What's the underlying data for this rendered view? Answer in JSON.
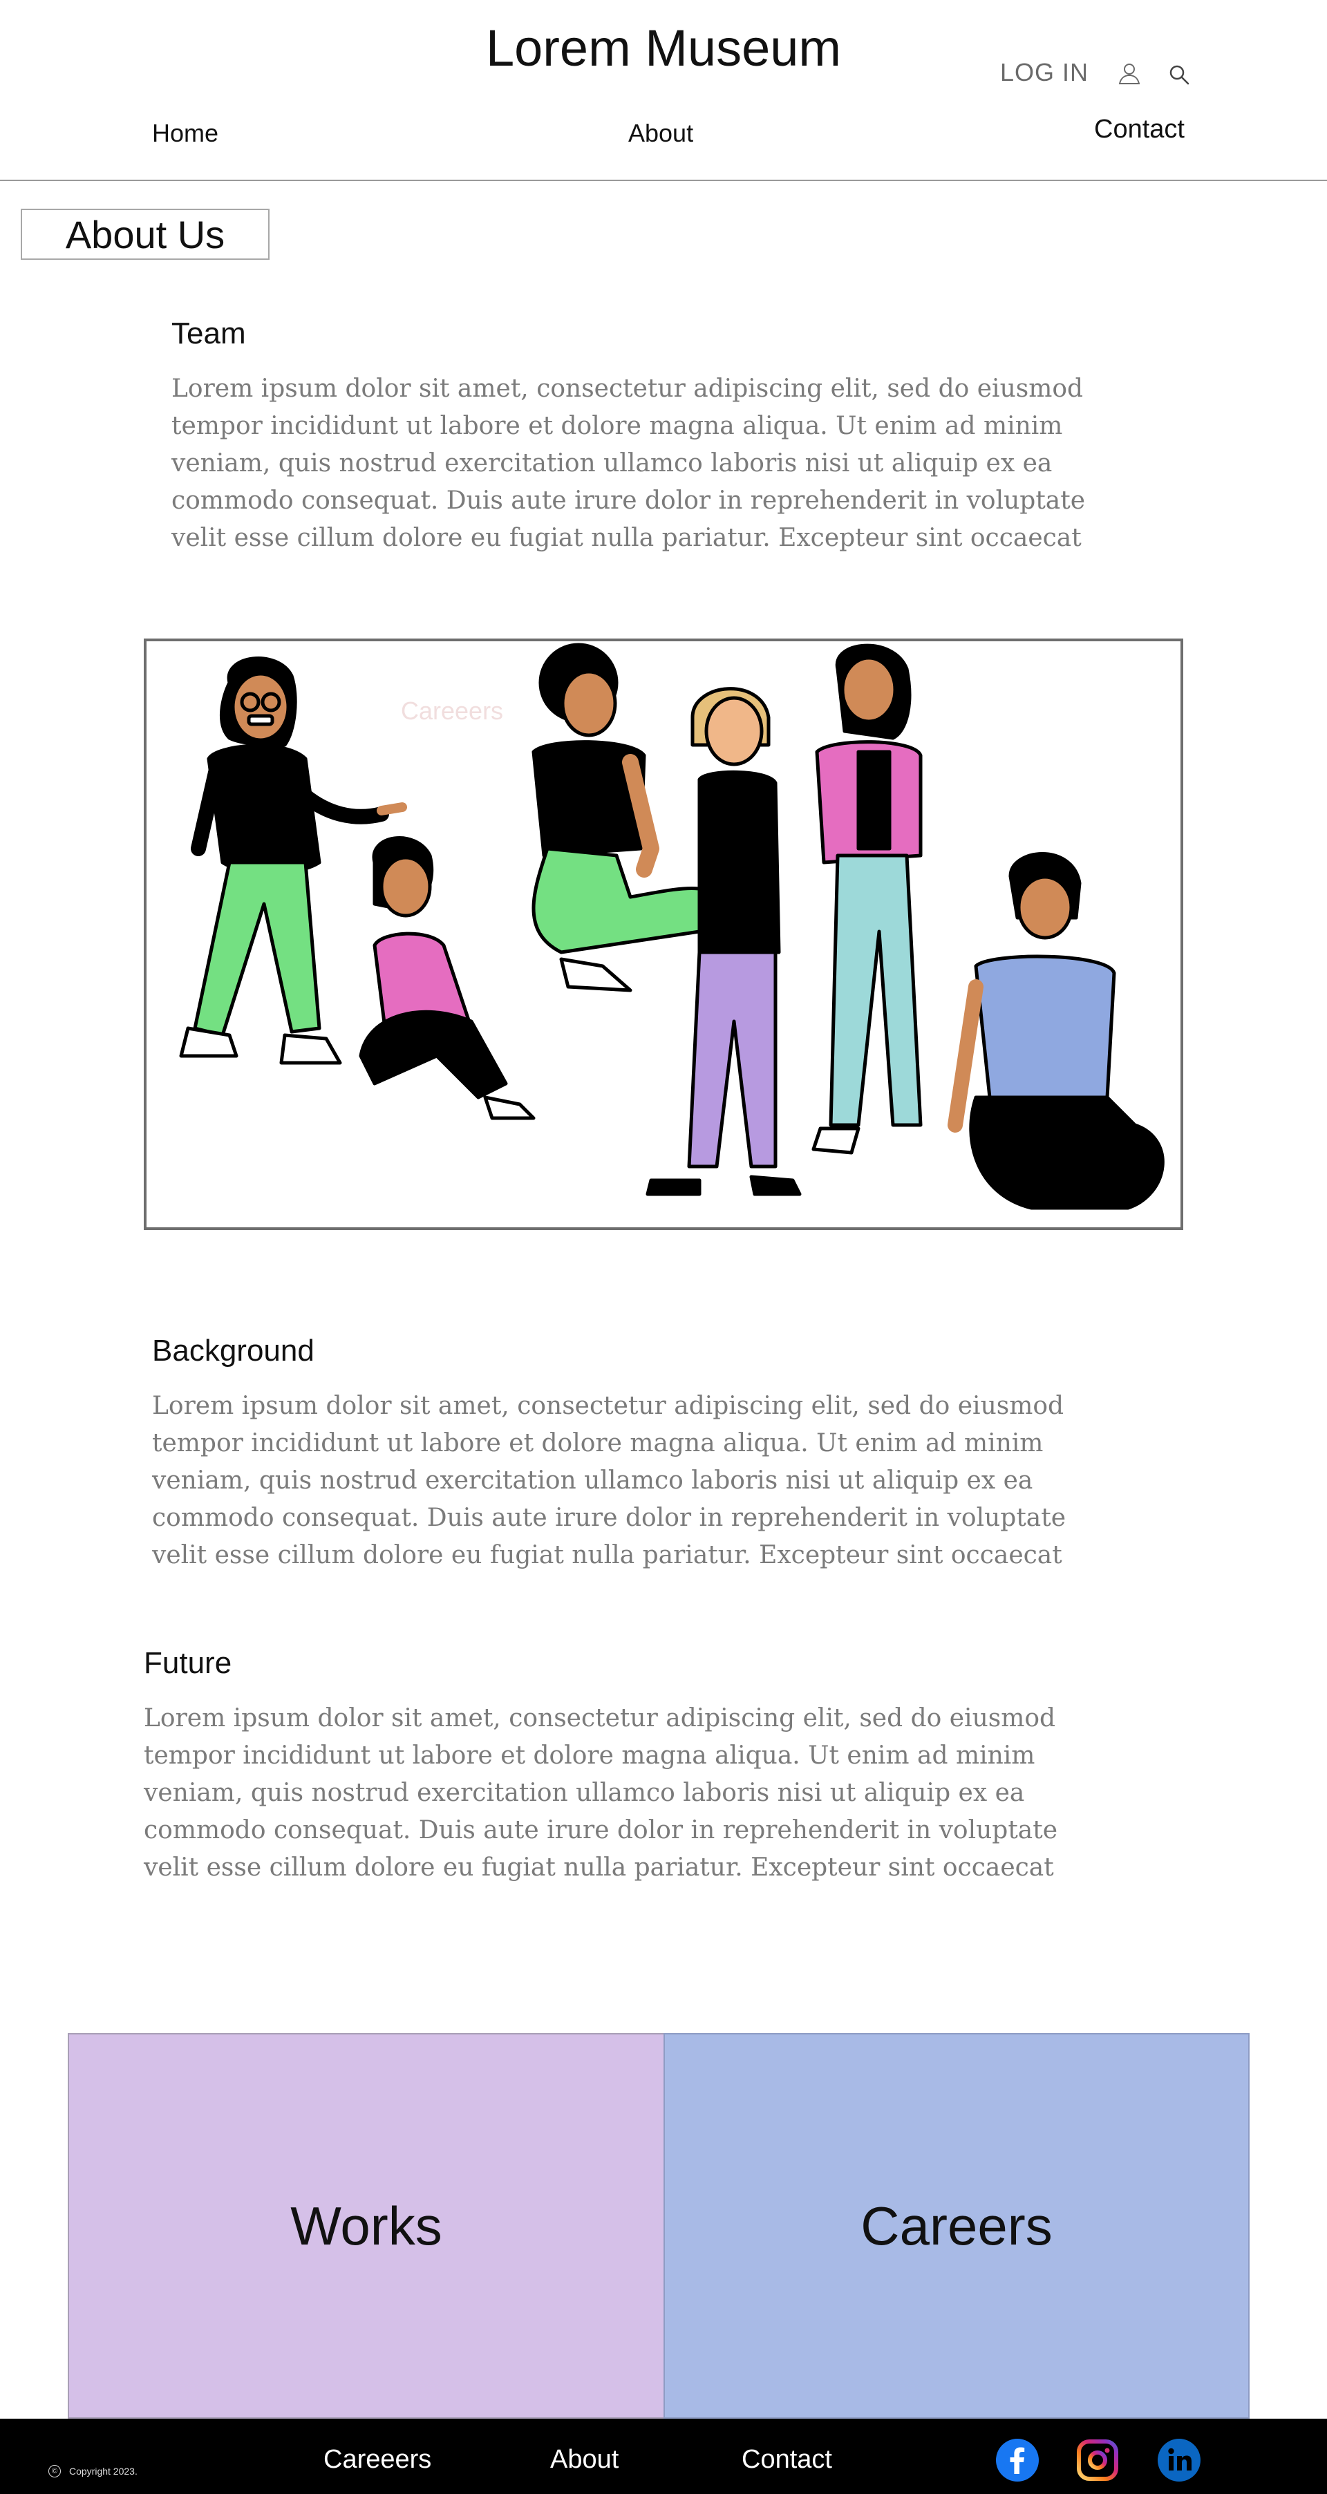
{
  "header": {
    "site_title": "Lorem Museum",
    "login_label": "LOG IN",
    "user_icon": "user-icon",
    "search_icon": "search-icon"
  },
  "nav": {
    "home": "Home",
    "about": "About",
    "contact": "Contact"
  },
  "page": {
    "heading": "About Us"
  },
  "sections": {
    "team": {
      "title": "Team",
      "lines": [
        "Lorem ipsum dolor sit amet, consectetur adipiscing elit, sed do eiusmod",
        "tempor incididunt ut labore et dolore magna aliqua. Ut enim ad minim",
        "veniam, quis nostrud exercitation ullamco laboris nisi ut aliquip ex ea",
        "commodo consequat. Duis aute irure dolor in reprehenderit in voluptate",
        "velit esse cillum dolore eu fugiat nulla pariatur. Excepteur sint occaecat"
      ]
    },
    "background": {
      "title": "Background",
      "lines": [
        "Lorem ipsum dolor sit amet, consectetur adipiscing elit, sed do eiusmod",
        "tempor incididunt ut labore et dolore magna aliqua. Ut enim ad minim",
        "veniam, quis nostrud exercitation ullamco laboris nisi ut aliquip ex ea",
        "commodo consequat. Duis aute irure dolor in reprehenderit in voluptate",
        "velit esse cillum dolore eu fugiat nulla pariatur. Excepteur sint occaecat"
      ]
    },
    "future": {
      "title": "Future",
      "lines": [
        "Lorem ipsum dolor sit amet, consectetur adipiscing elit, sed do eiusmod",
        "tempor incididunt ut labore et dolore magna aliqua. Ut enim ad minim",
        "veniam, quis nostrud exercitation ullamco laboris nisi ut aliquip ex ea",
        "commodo consequat. Duis aute irure dolor in reprehenderit in voluptate",
        "velit esse cillum dolore eu fugiat nulla pariatur. Excepteur sint occaecat"
      ]
    }
  },
  "illustration": {
    "caption": "Careeers"
  },
  "tiles": {
    "works": "Works",
    "careers": "Careers"
  },
  "footer": {
    "copyright": "Copyright 2023.",
    "links": {
      "careers": "Careeers",
      "about": "About",
      "contact": "Contact"
    },
    "social_icons": [
      "facebook-icon",
      "instagram-icon",
      "linkedin-icon"
    ]
  },
  "colors": {
    "works_tile": "#d5c0e8",
    "careers_tile": "#a8bae6",
    "footer_bg": "#000000",
    "body_text": "#7b7b7b"
  }
}
